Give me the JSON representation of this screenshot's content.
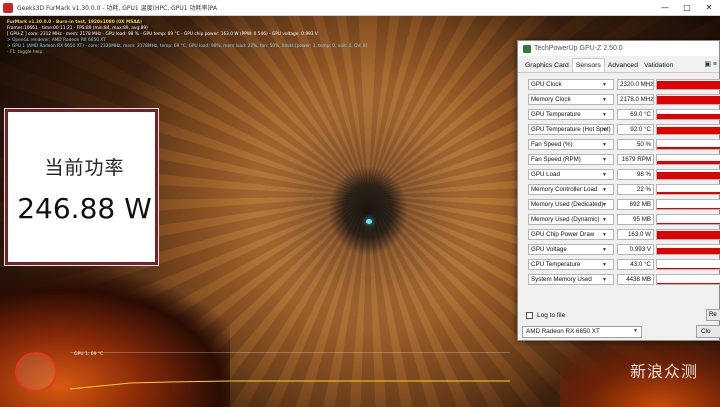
{
  "furmark": {
    "title": "Geeks3D FurMark v1.30.0.0 - 功耗, GPU1 温度(HPC, GPU1 功耗率)PA",
    "osd": [
      "FurMark v1.30.0.0 - Burn-in test, 1920x1080 (0X MSAA)",
      "Frames:10661 - time:00:11:21 - FPS:89 (min:84, max:89, avg:89)",
      "[ GPU-Z ] core: 2312 MHz - mem: 2178 MHz - GPU load: 98 % - GPU temp: 69 °C - GPU chip power: 163.0 W (PPW: 0.546) - GPU voltage: 0.993 V",
      "> OpenGL renderer: AMD Radeon RX 6650 XT",
      "> GPU 1 (AMD Radeon RX 6650 XT) - core: 2320MHz, mem: 2178MHz, temp: 69 °C, GPU load: 98%, mem load: 22%, fan: 50%, limits:[power: 1, temp: 0, volt: 0, OV: 0]",
      "- F1: toggle help"
    ],
    "graph_label": "GPU 1: 69 °C"
  },
  "power_overlay": {
    "label": "当前功率",
    "value": "246.88 W"
  },
  "gpuz": {
    "title": "TechPowerUp GPU-Z 2.50.0",
    "tabs": [
      "Graphics Card",
      "Sensors",
      "Advanced",
      "Validation"
    ],
    "active_tab": "Sensors",
    "sensors": [
      {
        "name": "GPU Clock",
        "value": "2320.0 MHz",
        "level": 0.9
      },
      {
        "name": "Memory Clock",
        "value": "2178.0 MHz",
        "level": 0.85
      },
      {
        "name": "GPU Temperature",
        "value": "69.0 °C",
        "level": 0.55
      },
      {
        "name": "GPU Temperature (Hot Spot)",
        "value": "92.0 °C",
        "level": 0.8
      },
      {
        "name": "Fan Speed (%)",
        "value": "50 %",
        "level": 0.25
      },
      {
        "name": "Fan Speed (RPM)",
        "value": "1679 RPM",
        "level": 0.35
      },
      {
        "name": "GPU Load",
        "value": "98 %",
        "level": 0.8
      },
      {
        "name": "Memory Controller Load",
        "value": "22 %",
        "level": 0.2
      },
      {
        "name": "Memory Used (Dedicated)",
        "value": "692 MB",
        "level": 0.1
      },
      {
        "name": "Memory Used (Dynamic)",
        "value": "95 MB",
        "level": 0.08
      },
      {
        "name": "GPU Chip Power Draw",
        "value": "163.0 W",
        "level": 0.85
      },
      {
        "name": "GPU Voltage",
        "value": "0.993 V",
        "level": 0.7
      },
      {
        "name": "CPU Temperature",
        "value": "43.0 °C",
        "level": 0.15
      },
      {
        "name": "System Memory Used",
        "value": "4438 MB",
        "level": 0.15
      }
    ],
    "log_label": "Log to file",
    "reset_label": "Re",
    "device": "AMD Radeon RX 6650 XT",
    "close_label": "Clo"
  },
  "watermark": "新浪众测",
  "colors": {
    "graph_red": "#e00000",
    "overlay_border": "#7a1f2a"
  }
}
